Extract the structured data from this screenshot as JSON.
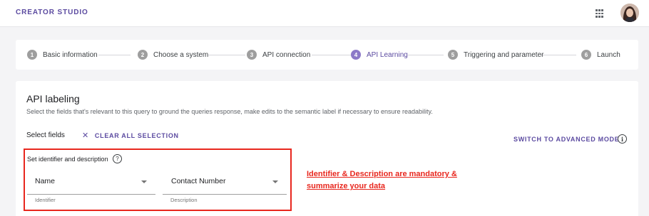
{
  "header": {
    "brand": "CREATOR STUDIO",
    "apps_icon": "apps-grid-icon",
    "avatar_icon": "user-avatar"
  },
  "stepper": {
    "active_step": 4,
    "steps": [
      {
        "num": "1",
        "label": "Basic information"
      },
      {
        "num": "2",
        "label": "Choose a system"
      },
      {
        "num": "3",
        "label": "API connection"
      },
      {
        "num": "4",
        "label": "API Learning"
      },
      {
        "num": "5",
        "label": "Triggering and parameter"
      },
      {
        "num": "6",
        "label": "Launch"
      }
    ]
  },
  "section": {
    "title": "API labeling",
    "subtitle": "Select the fields that's relevant to this query to ground the queries response, make edits to the semantic label if necessary to ensure readability.",
    "select_fields": "Select fields",
    "clear_all": "CLEAR ALL SELECTION",
    "advanced_mode": "SWITCH TO ADVANCED MODE",
    "info_icon": "info-circle-icon"
  },
  "identifier_box": {
    "heading": "Set identifier and description",
    "help_icon": "help-circle-icon",
    "identifier": {
      "value": "Name",
      "helper": "Identifier"
    },
    "description": {
      "value": "Contact Number",
      "helper": "Description"
    }
  },
  "annotation": {
    "line1": "Identifier & Description are mandatory &",
    "line2": "summarize your data"
  },
  "colors": {
    "accent": "#5b4aa0",
    "active_step": "#8c79c8",
    "annotation_red": "#e8271e"
  }
}
